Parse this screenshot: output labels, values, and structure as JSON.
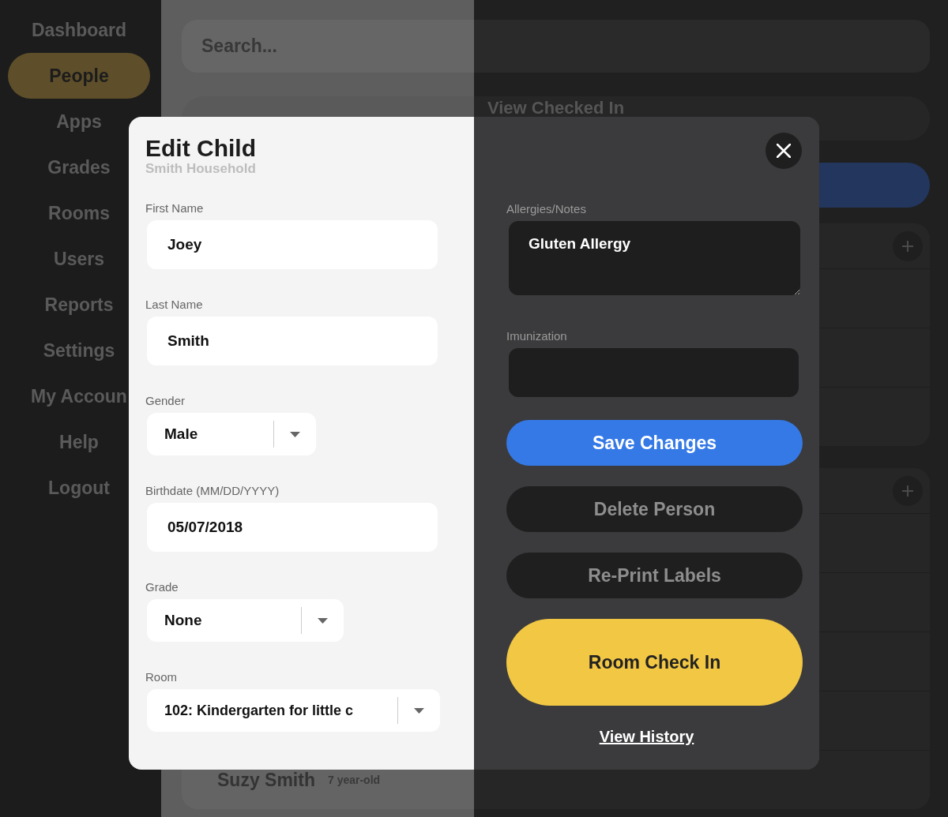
{
  "sidebar": {
    "items": [
      {
        "label": "Dashboard",
        "selected": false
      },
      {
        "label": "People",
        "selected": true
      },
      {
        "label": "Apps",
        "selected": false
      },
      {
        "label": "Grades",
        "selected": false
      },
      {
        "label": "Rooms",
        "selected": false
      },
      {
        "label": "Users",
        "selected": false
      },
      {
        "label": "Reports",
        "selected": false
      },
      {
        "label": "Settings",
        "selected": false
      },
      {
        "label": "My Accoun",
        "selected": false
      },
      {
        "label": "Help",
        "selected": false
      },
      {
        "label": "Logout",
        "selected": false
      }
    ]
  },
  "main": {
    "search": {
      "placeholder": "Search..."
    },
    "view_checked_in": "View Checked In",
    "person": {
      "name": "Suzy Smith",
      "age": "7 year-old"
    }
  },
  "modal": {
    "title": "Edit Child",
    "subtitle": "Smith Household",
    "fields": [
      {
        "label": "First Name",
        "value": "Joey",
        "kind": "text"
      },
      {
        "label": "Last Name",
        "value": "Smith",
        "kind": "text"
      },
      {
        "label": "Gender",
        "value": "Male",
        "kind": "select"
      },
      {
        "label": "Birthdate (MM/DD/YYYY)",
        "value": "05/07/2018",
        "kind": "text"
      },
      {
        "label": "Grade",
        "value": "None",
        "kind": "select"
      },
      {
        "label": "Room",
        "value": "102: Kindergarten for little c",
        "kind": "select"
      }
    ],
    "side_fields": [
      {
        "label": "Allergies/Notes",
        "value": "Gluten Allergy",
        "kind": "textarea"
      },
      {
        "label": "Imunization",
        "kind": "text"
      }
    ],
    "buttons": [
      {
        "label": "Save Changes",
        "kind": "primary"
      },
      {
        "label": "Delete Person",
        "kind": "secondary"
      },
      {
        "label": "Re-Print Labels",
        "kind": "secondary"
      },
      {
        "label": "Room Check In",
        "kind": "accent"
      }
    ],
    "link": "View History"
  }
}
